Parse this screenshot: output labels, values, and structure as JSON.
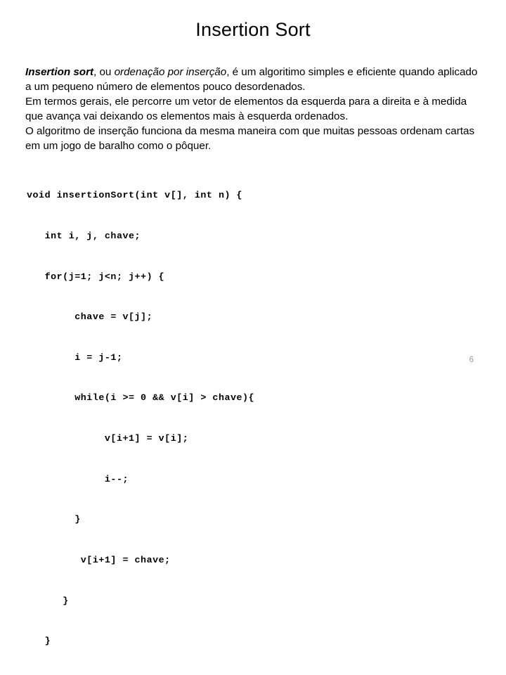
{
  "slide": {
    "title": "Insertion Sort",
    "page_number": "6",
    "background_color": "#ffffff",
    "text_color": "#000000",
    "page_number_color": "#9a9a9a",
    "paragraphs": [
      {
        "runs": [
          {
            "text": "Insertion sort",
            "style": "bold-italic"
          },
          {
            "text": ", ou ",
            "style": "regular"
          },
          {
            "text": "ordenação por inserção",
            "style": "italic"
          },
          {
            "text": ", é um algoritimo simples e eficiente quando aplicado a um pequeno número de elementos pouco desordenados.",
            "style": "regular"
          }
        ]
      },
      {
        "runs": [
          {
            "text": "Em termos gerais, ele percorre um vetor de elementos da esquerda para a direita e à medida que avança vai deixando os elementos mais à esquerda ordenados.",
            "style": "regular"
          }
        ]
      },
      {
        "runs": [
          {
            "text": "O algoritmo de inserção funciona da mesma maneira com que muitas pessoas ordenam cartas em um jogo de baralho como o pôquer.",
            "style": "regular"
          }
        ]
      }
    ],
    "code": {
      "language": "c",
      "lines": [
        "void insertionSort(int v[], int n) {",
        "   int i, j, chave;",
        "   for(j=1; j<n; j++) {",
        "        chave = v[j];",
        "        i = j-1;",
        "        while(i >= 0 && v[i] > chave){",
        "             v[i+1] = v[i];",
        "             i--;",
        "        }",
        "         v[i+1] = chave;",
        "      }",
        "   }"
      ]
    }
  }
}
